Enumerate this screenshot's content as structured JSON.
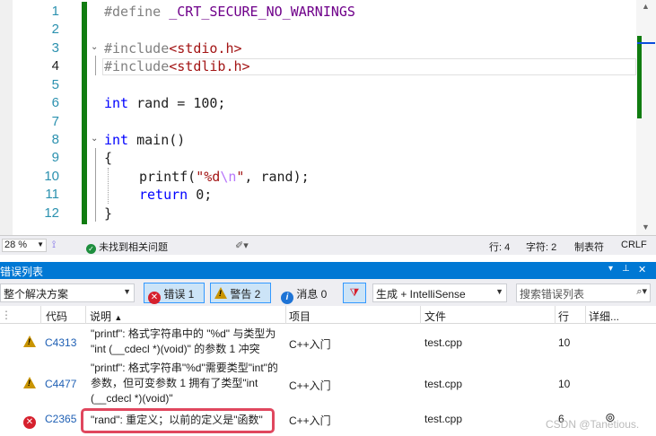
{
  "editor": {
    "line_numbers": [
      "1",
      "2",
      "3",
      "4",
      "5",
      "6",
      "7",
      "8",
      "9",
      "10",
      "11",
      "12"
    ],
    "lines": {
      "l1_directive": "#define",
      "l1_macro": "_CRT_SECURE_NO_WARNINGS",
      "l3_directive": "#include",
      "l3_header": "<stdio.h>",
      "l4_directive": "#include",
      "l4_header": "<stdlib.h>",
      "l6_kw": "int",
      "l6_rest": "rand = 100;",
      "l8_kw": "int",
      "l8_rest": "main()",
      "l9": "{",
      "l10_fn": "printf(",
      "l10_str_a": "\"%d",
      "l10_esc": "\\n",
      "l10_str_b": "\"",
      "l10_rest": ", rand);",
      "l11_kw": "return",
      "l11_rest": "0;",
      "l12": "}"
    }
  },
  "status_bar": {
    "zoom": "28 %",
    "issues_text": "未找到相关问题",
    "line": "行: 4",
    "char": "字符: 2",
    "whitespace": "制表符",
    "line_ending": "CRLF"
  },
  "error_list": {
    "title": "错误列表",
    "title_buttons": [
      "▾",
      "📌",
      "✕"
    ],
    "scope": "整个解决方案",
    "errors_btn": "错误 1",
    "warnings_btn": "警告 2",
    "messages_btn": "消息 0",
    "build_filter": "生成 + IntelliSense",
    "search_placeholder": "搜索错误列表",
    "columns": {
      "code": "代码",
      "description": "说明",
      "project": "项目",
      "file": "文件",
      "line": "行",
      "detail": "详细..."
    },
    "rows": [
      {
        "severity": "warning",
        "code": "C4313",
        "description": "\"printf\": 格式字符串中的 \"%d\" 与类型为 \"int (__cdecl *)(void)\" 的参数 1 冲突",
        "project": "C++入门",
        "file": "test.cpp",
        "line": "10"
      },
      {
        "severity": "warning",
        "code": "C4477",
        "description": "\"printf\": 格式字符串\"%d\"需要类型\"int\"的参数，但可变参数 1 拥有了类型\"int (__cdecl *)(void)\"",
        "project": "C++入门",
        "file": "test.cpp",
        "line": "10"
      },
      {
        "severity": "error",
        "code": "C2365",
        "description": "\"rand\": 重定义；以前的定义是\"函数\"",
        "project": "C++入门",
        "file": "test.cpp",
        "line": "6"
      }
    ]
  },
  "watermark": "CSDN @Tanetious."
}
